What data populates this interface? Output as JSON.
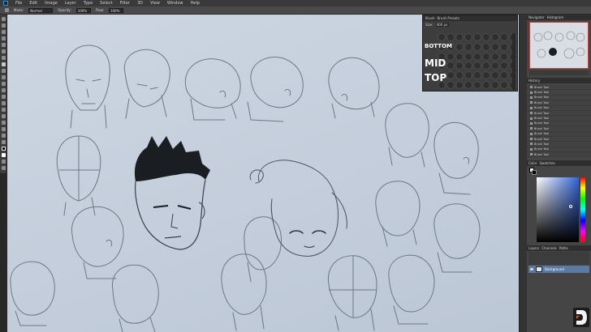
{
  "menubar": {
    "items": [
      "File",
      "Edit",
      "Image",
      "Layer",
      "Type",
      "Select",
      "Filter",
      "3D",
      "View",
      "Window",
      "Help"
    ]
  },
  "options": {
    "mode_label": "Mode:",
    "mode_value": "Normal",
    "opacity_label": "Opacity:",
    "opacity_value": "100%",
    "flow_label": "Flow:",
    "flow_value": "100%"
  },
  "brush_panel": {
    "tabs": [
      "Brush",
      "Brush Presets"
    ],
    "size_label": "Size:",
    "size_value": "400 px",
    "words": [
      "BOTTOM",
      "MID",
      "TOP"
    ]
  },
  "navigator": {
    "tabs": [
      "Navigator",
      "Histogram"
    ]
  },
  "history": {
    "tab": "History",
    "item_label": "Brush Tool",
    "count": 14
  },
  "color": {
    "tabs": [
      "Color",
      "Swatches"
    ],
    "accent": "#3264d8"
  },
  "layers": {
    "tabs": [
      "Layers",
      "Channels",
      "Paths"
    ],
    "layer_name": "Background"
  },
  "icons": [
    "move-icon",
    "marquee-icon",
    "lasso-icon",
    "brush-icon",
    "eraser-icon",
    "eyedropper-icon",
    "zoom-icon"
  ]
}
